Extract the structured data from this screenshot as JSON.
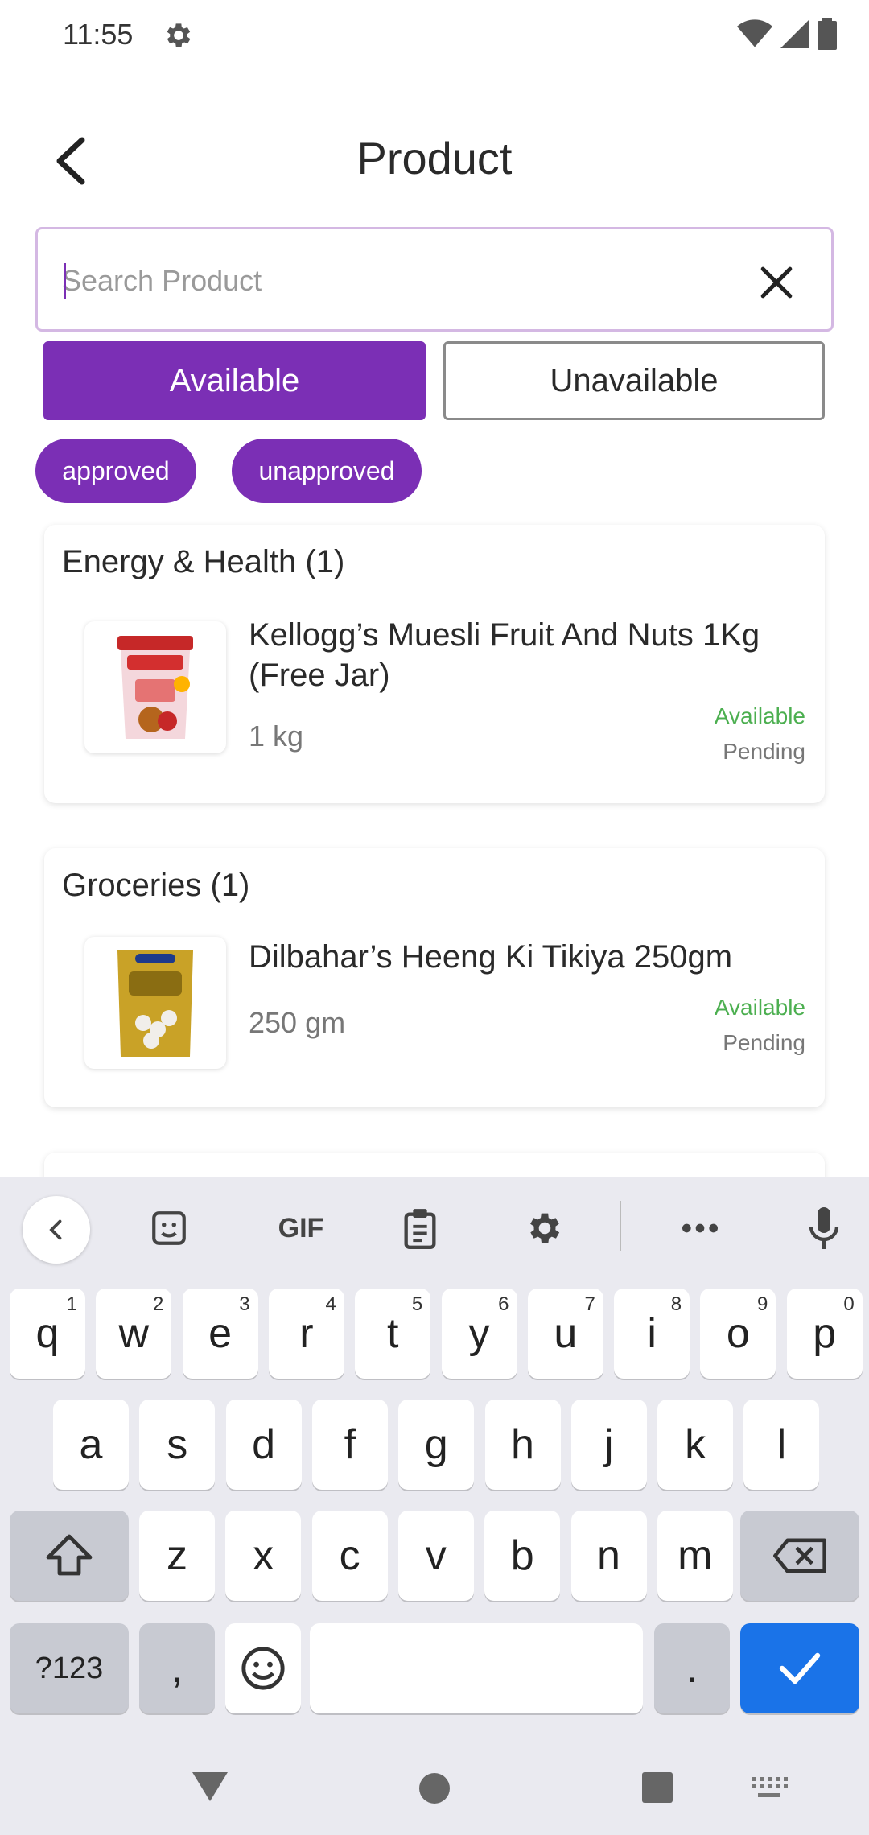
{
  "status_bar": {
    "time": "11:55"
  },
  "header": {
    "title": "Product"
  },
  "search": {
    "placeholder": "Search Product",
    "value": ""
  },
  "filters": {
    "available": "Available",
    "unavailable": "Unavailable"
  },
  "chips": {
    "approved": "approved",
    "unapproved": "unapproved"
  },
  "categories": [
    {
      "title": "Energy & Health (1)",
      "product": {
        "name": "Kellogg’s Muesli Fruit And Nuts 1Kg (Free Jar)",
        "quantity": "1 kg",
        "availability": "Available",
        "approval": "Pending"
      }
    },
    {
      "title": "Groceries (1)",
      "product": {
        "name": "Dilbahar’s Heeng Ki Tikiya 250gm",
        "quantity": "250 gm",
        "availability": "Available",
        "approval": "Pending"
      }
    }
  ],
  "keyboard": {
    "gif_label": "GIF",
    "row1": [
      {
        "k": "q",
        "n": "1"
      },
      {
        "k": "w",
        "n": "2"
      },
      {
        "k": "e",
        "n": "3"
      },
      {
        "k": "r",
        "n": "4"
      },
      {
        "k": "t",
        "n": "5"
      },
      {
        "k": "y",
        "n": "6"
      },
      {
        "k": "u",
        "n": "7"
      },
      {
        "k": "i",
        "n": "8"
      },
      {
        "k": "o",
        "n": "9"
      },
      {
        "k": "p",
        "n": "0"
      }
    ],
    "row2": [
      "a",
      "s",
      "d",
      "f",
      "g",
      "h",
      "j",
      "k",
      "l"
    ],
    "row3": [
      "z",
      "x",
      "c",
      "v",
      "b",
      "n",
      "m"
    ],
    "symbols": "?123",
    "comma": ",",
    "period": "."
  },
  "colors": {
    "accent": "#7b2fb5",
    "available": "#4caf50",
    "enter": "#1a73e8"
  }
}
